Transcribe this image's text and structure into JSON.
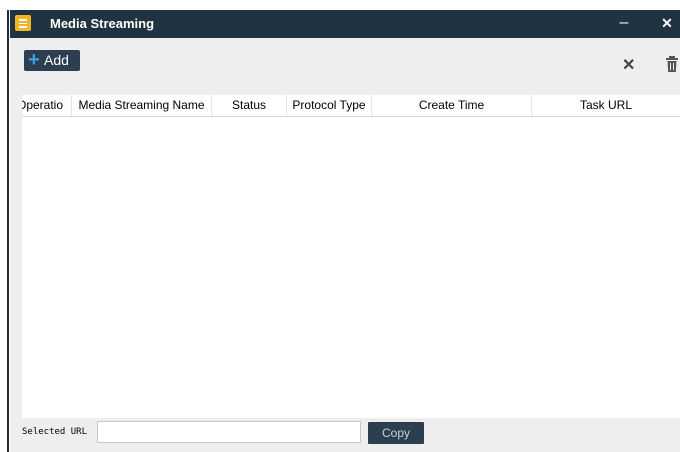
{
  "window": {
    "title": "Media Streaming",
    "minimize_icon": "minimize-icon",
    "close_icon": "close-icon",
    "app_icon": "document-icon"
  },
  "toolbar": {
    "add_label": "Add",
    "add_icon": "plus-icon",
    "remove_icon": "x-icon",
    "delete_icon": "trash-icon"
  },
  "table": {
    "columns": [
      "Operatio",
      "Media Streaming Name",
      "Status",
      "Protocol Type",
      "Create Time",
      "Task URL"
    ],
    "rows": []
  },
  "footer": {
    "selected_url_label": "Selected URL",
    "selected_url_value": "",
    "copy_label": "Copy"
  },
  "colors": {
    "titlebar": "#1f3340",
    "button_dark": "#2c3e4f",
    "plus_accent": "#39a0e8",
    "app_icon": "#f0b429",
    "window_bg": "#eeeeee"
  }
}
